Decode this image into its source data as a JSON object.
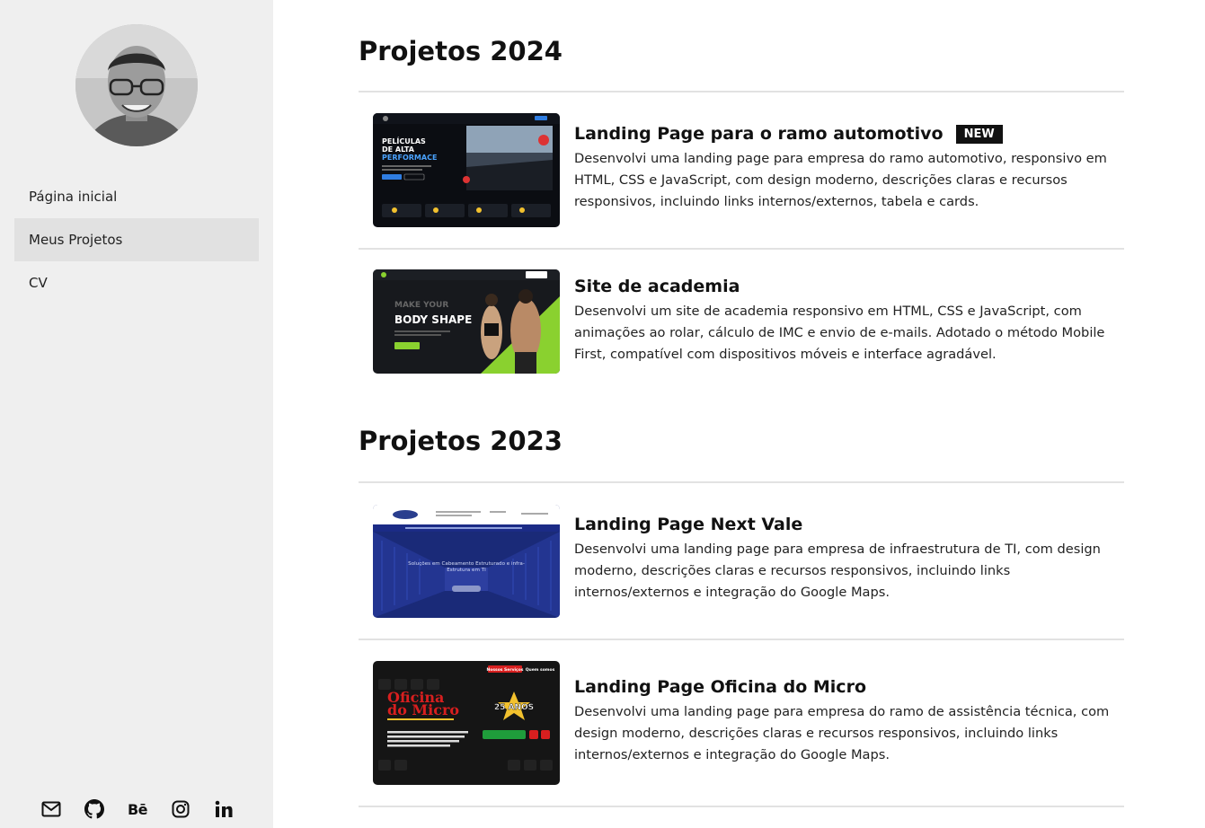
{
  "sidebar": {
    "nav": [
      {
        "label": "Página inicial",
        "active": false
      },
      {
        "label": "Meus Projetos",
        "active": true
      },
      {
        "label": "CV",
        "active": false
      }
    ],
    "social_icons": [
      "mail-icon",
      "github-icon",
      "behance-icon",
      "instagram-icon",
      "linkedin-icon"
    ],
    "behance_text": "Bē"
  },
  "sections": [
    {
      "title": "Projetos 2024",
      "projects": [
        {
          "title": "Landing Page para o ramo automotivo",
          "badge": "NEW",
          "description": "Desenvolvi uma landing page para empresa do ramo automotivo, responsivo em HTML, CSS e JavaScript, com design moderno, descrições claras e recursos responsivos, incluindo links internos/externos, tabela e cards.",
          "thumb": {
            "line1": "PELÍCULAS",
            "line2": "DE ALTA",
            "line3": "PERFORMACE"
          }
        },
        {
          "title": "Site de academia",
          "badge": "",
          "description": "Desenvolvi um site de academia responsivo em HTML, CSS e JavaScript, com animações ao rolar, cálculo de IMC e envio de e-mails. Adotado o método Mobile First, compatível com dispositivos móveis e interface agradável.",
          "thumb": {
            "line1": "MAKE YOUR",
            "line2": "BODY SHAPE"
          }
        }
      ]
    },
    {
      "title": "Projetos 2023",
      "projects": [
        {
          "title": "Landing Page Next Vale",
          "badge": "",
          "description": "Desenvolvi uma landing page para empresa de infraestrutura de TI, com design moderno, descrições claras e recursos responsivos, incluindo links internos/externos e integração do Google Maps.",
          "thumb": {
            "line1": "Soluções em Cabeamento Estruturado e infra-",
            "line2": "Estrutura em TI"
          }
        },
        {
          "title": "Landing Page Oficina do Micro",
          "badge": "",
          "description": "Desenvolvi uma landing page para empresa do ramo de assistência técnica, com design moderno, descrições claras e recursos responsivos, incluindo links internos/externos e integração do Google Maps.",
          "thumb": {
            "line1": "Oficina",
            "line2": "do Micro",
            "line3": "25 ANOS",
            "nav1": "Nossos Serviços",
            "nav2": "Quem somos"
          }
        }
      ]
    }
  ],
  "colors": {
    "sidebar_bg": "#efefef",
    "active_item_bg": "#e1e1e1",
    "badge_bg": "#111111",
    "gym_accent": "#8ad12f",
    "auto_accent": "#2f7de1",
    "oficina_red": "#d81f1f"
  }
}
